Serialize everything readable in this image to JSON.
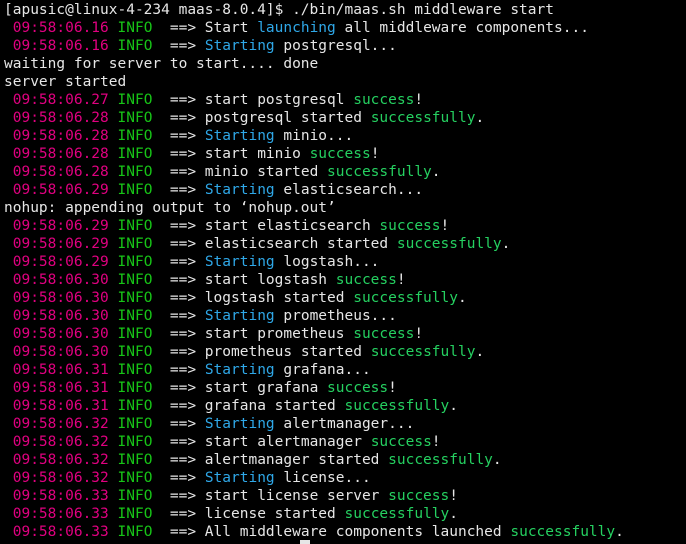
{
  "terminal": {
    "lines": [
      {
        "kind": "plain",
        "text": "[apusic@linux-4-234 maas-8.0.4]$ ./bin/maas.sh middleware start"
      },
      {
        "kind": "log",
        "time": "09:58:06.16",
        "level": "INFO",
        "parts": [
          {
            "s": "w",
            "v": "==> Start "
          },
          {
            "s": "c",
            "v": "launching"
          },
          {
            "s": "w",
            "v": " all middleware components..."
          }
        ]
      },
      {
        "kind": "log",
        "time": "09:58:06.16",
        "level": "INFO",
        "parts": [
          {
            "s": "w",
            "v": "==> "
          },
          {
            "s": "c",
            "v": "Starting"
          },
          {
            "s": "w",
            "v": " postgresql..."
          }
        ]
      },
      {
        "kind": "plain",
        "text": "waiting for server to start.... done"
      },
      {
        "kind": "plain",
        "text": "server started"
      },
      {
        "kind": "log",
        "time": "09:58:06.27",
        "level": "INFO",
        "parts": [
          {
            "s": "w",
            "v": "==> start postgresql "
          },
          {
            "s": "g",
            "v": "success"
          },
          {
            "s": "w",
            "v": "!"
          }
        ]
      },
      {
        "kind": "log",
        "time": "09:58:06.28",
        "level": "INFO",
        "parts": [
          {
            "s": "w",
            "v": "==> postgresql started "
          },
          {
            "s": "g",
            "v": "successfully"
          },
          {
            "s": "w",
            "v": "."
          }
        ]
      },
      {
        "kind": "log",
        "time": "09:58:06.28",
        "level": "INFO",
        "parts": [
          {
            "s": "w",
            "v": "==> "
          },
          {
            "s": "c",
            "v": "Starting"
          },
          {
            "s": "w",
            "v": " minio..."
          }
        ]
      },
      {
        "kind": "log",
        "time": "09:58:06.28",
        "level": "INFO",
        "parts": [
          {
            "s": "w",
            "v": "==> start minio "
          },
          {
            "s": "g",
            "v": "success"
          },
          {
            "s": "w",
            "v": "!"
          }
        ]
      },
      {
        "kind": "log",
        "time": "09:58:06.28",
        "level": "INFO",
        "parts": [
          {
            "s": "w",
            "v": "==> minio started "
          },
          {
            "s": "g",
            "v": "successfully"
          },
          {
            "s": "w",
            "v": "."
          }
        ]
      },
      {
        "kind": "log",
        "time": "09:58:06.29",
        "level": "INFO",
        "parts": [
          {
            "s": "w",
            "v": "==> "
          },
          {
            "s": "c",
            "v": "Starting"
          },
          {
            "s": "w",
            "v": " elasticsearch..."
          }
        ]
      },
      {
        "kind": "plain",
        "text": "nohup: appending output to ‘nohup.out’"
      },
      {
        "kind": "log",
        "time": "09:58:06.29",
        "level": "INFO",
        "parts": [
          {
            "s": "w",
            "v": "==> start elasticsearch "
          },
          {
            "s": "g",
            "v": "success"
          },
          {
            "s": "w",
            "v": "!"
          }
        ]
      },
      {
        "kind": "log",
        "time": "09:58:06.29",
        "level": "INFO",
        "parts": [
          {
            "s": "w",
            "v": "==> elasticsearch started "
          },
          {
            "s": "g",
            "v": "successfully"
          },
          {
            "s": "w",
            "v": "."
          }
        ]
      },
      {
        "kind": "log",
        "time": "09:58:06.29",
        "level": "INFO",
        "parts": [
          {
            "s": "w",
            "v": "==> "
          },
          {
            "s": "c",
            "v": "Starting"
          },
          {
            "s": "w",
            "v": " logstash..."
          }
        ]
      },
      {
        "kind": "log",
        "time": "09:58:06.30",
        "level": "INFO",
        "parts": [
          {
            "s": "w",
            "v": "==> start logstash "
          },
          {
            "s": "g",
            "v": "success"
          },
          {
            "s": "w",
            "v": "!"
          }
        ]
      },
      {
        "kind": "log",
        "time": "09:58:06.30",
        "level": "INFO",
        "parts": [
          {
            "s": "w",
            "v": "==> logstash started "
          },
          {
            "s": "g",
            "v": "successfully"
          },
          {
            "s": "w",
            "v": "."
          }
        ]
      },
      {
        "kind": "log",
        "time": "09:58:06.30",
        "level": "INFO",
        "parts": [
          {
            "s": "w",
            "v": "==> "
          },
          {
            "s": "c",
            "v": "Starting"
          },
          {
            "s": "w",
            "v": " prometheus..."
          }
        ]
      },
      {
        "kind": "log",
        "time": "09:58:06.30",
        "level": "INFO",
        "parts": [
          {
            "s": "w",
            "v": "==> start prometheus "
          },
          {
            "s": "g",
            "v": "success"
          },
          {
            "s": "w",
            "v": "!"
          }
        ]
      },
      {
        "kind": "log",
        "time": "09:58:06.30",
        "level": "INFO",
        "parts": [
          {
            "s": "w",
            "v": "==> prometheus started "
          },
          {
            "s": "g",
            "v": "successfully"
          },
          {
            "s": "w",
            "v": "."
          }
        ]
      },
      {
        "kind": "log",
        "time": "09:58:06.31",
        "level": "INFO",
        "parts": [
          {
            "s": "w",
            "v": "==> "
          },
          {
            "s": "c",
            "v": "Starting"
          },
          {
            "s": "w",
            "v": " grafana..."
          }
        ]
      },
      {
        "kind": "log",
        "time": "09:58:06.31",
        "level": "INFO",
        "parts": [
          {
            "s": "w",
            "v": "==> start grafana "
          },
          {
            "s": "g",
            "v": "success"
          },
          {
            "s": "w",
            "v": "!"
          }
        ]
      },
      {
        "kind": "log",
        "time": "09:58:06.31",
        "level": "INFO",
        "parts": [
          {
            "s": "w",
            "v": "==> grafana started "
          },
          {
            "s": "g",
            "v": "successfully"
          },
          {
            "s": "w",
            "v": "."
          }
        ]
      },
      {
        "kind": "log",
        "time": "09:58:06.32",
        "level": "INFO",
        "parts": [
          {
            "s": "w",
            "v": "==> "
          },
          {
            "s": "c",
            "v": "Starting"
          },
          {
            "s": "w",
            "v": " alertmanager..."
          }
        ]
      },
      {
        "kind": "log",
        "time": "09:58:06.32",
        "level": "INFO",
        "parts": [
          {
            "s": "w",
            "v": "==> start alertmanager "
          },
          {
            "s": "g",
            "v": "success"
          },
          {
            "s": "w",
            "v": "!"
          }
        ]
      },
      {
        "kind": "log",
        "time": "09:58:06.32",
        "level": "INFO",
        "parts": [
          {
            "s": "w",
            "v": "==> alertmanager started "
          },
          {
            "s": "g",
            "v": "successfully"
          },
          {
            "s": "w",
            "v": "."
          }
        ]
      },
      {
        "kind": "log",
        "time": "09:58:06.32",
        "level": "INFO",
        "parts": [
          {
            "s": "w",
            "v": "==> "
          },
          {
            "s": "c",
            "v": "Starting"
          },
          {
            "s": "w",
            "v": " license..."
          }
        ]
      },
      {
        "kind": "log",
        "time": "09:58:06.33",
        "level": "INFO",
        "parts": [
          {
            "s": "w",
            "v": "==> start license server "
          },
          {
            "s": "g",
            "v": "success"
          },
          {
            "s": "w",
            "v": "!"
          }
        ]
      },
      {
        "kind": "log",
        "time": "09:58:06.33",
        "level": "INFO",
        "parts": [
          {
            "s": "w",
            "v": "==> license started "
          },
          {
            "s": "g",
            "v": "successfully"
          },
          {
            "s": "w",
            "v": "."
          }
        ]
      },
      {
        "kind": "log",
        "time": "09:58:06.33",
        "level": "INFO",
        "parts": [
          {
            "s": "w",
            "v": "==> All middleware components launched "
          },
          {
            "s": "g",
            "v": "successfully"
          },
          {
            "s": "w",
            "v": "."
          }
        ]
      }
    ]
  },
  "colors": {
    "background": "#000000",
    "text": "#e6e6e6",
    "timestamp": "#e00080",
    "level": "#17c417",
    "starting": "#2fa8e8",
    "success": "#25d060"
  }
}
